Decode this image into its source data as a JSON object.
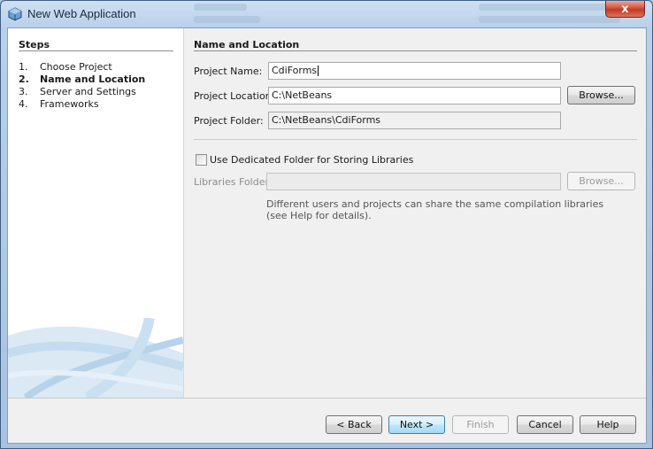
{
  "window": {
    "title": "New Web Application",
    "close_glyph": "x"
  },
  "steps": {
    "heading": "Steps",
    "items": [
      {
        "num": "1.",
        "label": "Choose Project"
      },
      {
        "num": "2.",
        "label": "Name and Location"
      },
      {
        "num": "3.",
        "label": "Server and Settings"
      },
      {
        "num": "4.",
        "label": "Frameworks"
      }
    ],
    "current_index": 1
  },
  "panel": {
    "heading": "Name and Location",
    "project_name": {
      "label": "Project Name:",
      "value": "CdiForms"
    },
    "project_location": {
      "label": "Project Location:",
      "value": "C:\\NetBeans",
      "browse": "Browse..."
    },
    "project_folder": {
      "label": "Project Folder:",
      "value": "C:\\NetBeans\\CdiForms"
    },
    "dedicated_folder": {
      "label": "Use Dedicated Folder for Storing Libraries",
      "checked": false
    },
    "libraries_folder": {
      "label": "Libraries Folder:",
      "value": "",
      "browse": "Browse..."
    },
    "hint_line1": "Different users and projects can share the same compilation libraries",
    "hint_line2": "(see Help for details)."
  },
  "buttons": {
    "back": "< Back",
    "next": "Next >",
    "finish": "Finish",
    "cancel": "Cancel",
    "help": "Help"
  },
  "colors": {
    "accent": "#3c7fb1",
    "close": "#c13a24"
  }
}
